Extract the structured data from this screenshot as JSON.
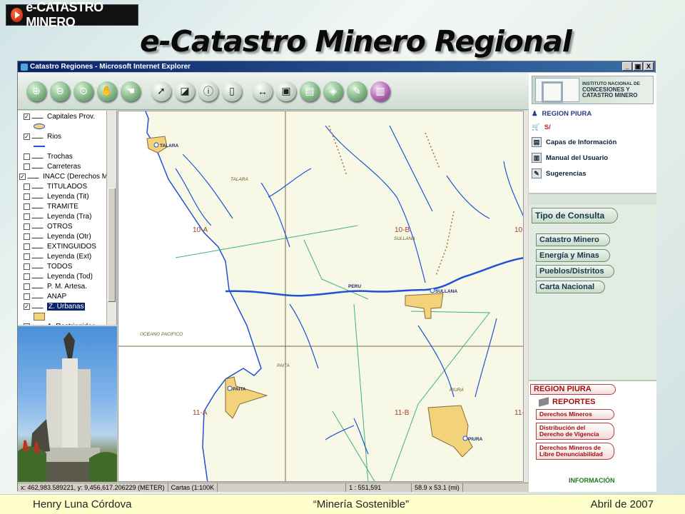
{
  "slide": {
    "logo_text": "e-CATASTRO MINERO",
    "title": "e-Catastro Minero Regional",
    "footer": {
      "left": "Henry Luna Córdova",
      "center": "“Minería Sostenible”",
      "right": "Abril de 2007"
    }
  },
  "window": {
    "title": "Catastro Regiones - Microsoft Internet Explorer",
    "buttons": [
      "_",
      "▣",
      "X"
    ]
  },
  "toolbar": {
    "icons": [
      "zoom-in-icon",
      "zoom-out-icon",
      "zoom-full-icon",
      "pan-map-icon",
      "hand-pan-icon",
      "select-arrow-icon",
      "eraser-icon",
      "info-icon",
      "document-icon",
      "measure-icon",
      "save-icon",
      "print-icon",
      "layers-icon",
      "tools-icon",
      "help-book-icon"
    ]
  },
  "layers": [
    {
      "label": "Capitales Prov.",
      "checked": true
    },
    {
      "label": "",
      "legend": true
    },
    {
      "label": "Rios",
      "checked": true
    },
    {
      "label": "",
      "legend": true
    },
    {
      "label": "Trochas",
      "checked": false
    },
    {
      "label": "Carreteras",
      "checked": false
    },
    {
      "label": "INACC (Derechos M",
      "checked": true,
      "group": true
    },
    {
      "label": "TITULADOS",
      "checked": false
    },
    {
      "label": "Leyenda (Tit)",
      "checked": false
    },
    {
      "label": "TRAMITE",
      "checked": false
    },
    {
      "label": "Leyenda (Tra)",
      "checked": false
    },
    {
      "label": "OTROS",
      "checked": false
    },
    {
      "label": "Leyenda (Otr)",
      "checked": false
    },
    {
      "label": "EXTINGUIDOS",
      "checked": false
    },
    {
      "label": "Leyenda (Ext)",
      "checked": false
    },
    {
      "label": "TODOS",
      "checked": false
    },
    {
      "label": "Leyenda (Tod)",
      "checked": false
    },
    {
      "label": "P. M. Artesa.",
      "checked": false
    },
    {
      "label": "ANAP",
      "checked": false
    },
    {
      "label": "Z. Urbanas",
      "checked": true,
      "selected": true
    },
    {
      "label": "",
      "legend": true
    },
    {
      "label": "A. Restringidas",
      "checked": false
    }
  ],
  "map": {
    "grid_labels": [
      "10-A",
      "10-B",
      "10-",
      "11-A",
      "11-B",
      "11-"
    ],
    "places": [
      "TALARA",
      "TALARA",
      "SULLANA",
      "SULLANA",
      "PERU",
      "PAITA",
      "PAITA",
      "PIURA",
      "PIURA"
    ],
    "ocean": "OCEANO PACIFICO"
  },
  "status": {
    "coords": "x: 462,983.589221, y: 9,456,617.206229 (METER)",
    "cartas": "Cartas (1:100K",
    "scale": "1 : 551,591",
    "extent": "58.9 x 53.1 (mi)"
  },
  "right_panel": {
    "inacc_text": [
      "INSTITUTO NACIONAL DE",
      "CONCESIONES Y",
      "CATASTRO MINERO"
    ],
    "inacc_abbr": "INACC",
    "region": "REGION PIURA",
    "currency": "S/",
    "links": [
      "Capas de Información",
      "Manual del Usuario",
      "Sugerencias"
    ],
    "consulta_title": "Tipo de Consulta",
    "consulta": [
      "Catastro Minero",
      "Energía y Minas",
      "Pueblos/Distritos",
      "Carta Nacional"
    ],
    "region_btn": "REGION PIURA",
    "reportes": "REPORTES",
    "report_items": [
      "Derechos Mineros",
      "Distribución del Derecho de Vigencia",
      "Derechos Mineros de Libre Denunciabilidad"
    ],
    "info": "INFORMACIÓN"
  },
  "colors": {
    "water": "#1f52d6",
    "urban": "#f2d27a",
    "grid": "#8a6a3a",
    "boundary": "#3fb07a",
    "land": "#f7f9e6"
  }
}
